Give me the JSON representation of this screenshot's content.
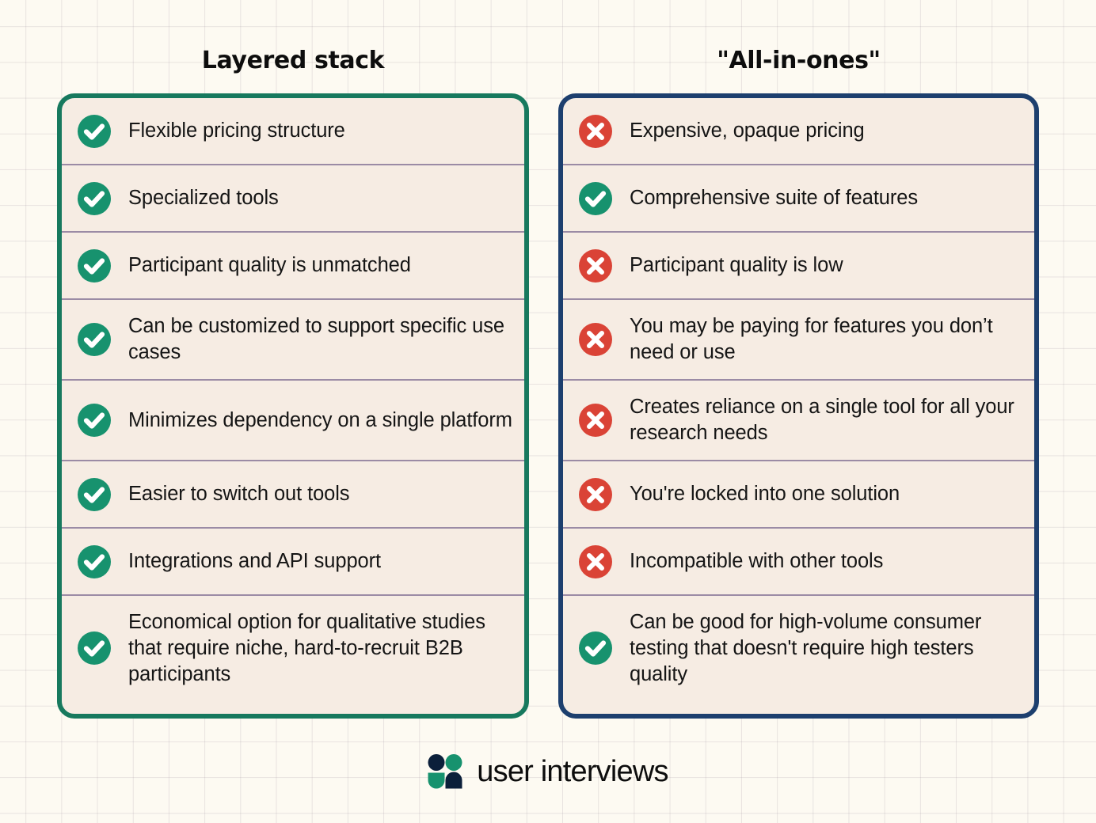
{
  "background": {
    "canvas_color": "#fdfaf2",
    "grid_line_color": "#9687961f"
  },
  "colors": {
    "green_accent": "#17795e",
    "green_icon": "#17926e",
    "navy_accent": "#1d3f6e",
    "navy_logo": "#0b1f3a",
    "red_icon": "#da4336",
    "card_background": "#f6ece3",
    "divider": "#9b8ba5",
    "text": "#151515"
  },
  "columns": [
    {
      "title": "Layered stack",
      "accent": "#17795e",
      "items": [
        {
          "icon": "check-icon",
          "status": "pro",
          "text": "Flexible pricing structure"
        },
        {
          "icon": "check-icon",
          "status": "pro",
          "text": "Specialized tools"
        },
        {
          "icon": "check-icon",
          "status": "pro",
          "text": "Participant quality is unmatched"
        },
        {
          "icon": "check-icon",
          "status": "pro",
          "text": "Can be customized to support specific use cases"
        },
        {
          "icon": "check-icon",
          "status": "pro",
          "text": "Minimizes dependency on a single platform"
        },
        {
          "icon": "check-icon",
          "status": "pro",
          "text": "Easier to switch out tools"
        },
        {
          "icon": "check-icon",
          "status": "pro",
          "text": "Integrations and API support"
        },
        {
          "icon": "check-icon",
          "status": "pro",
          "text": "Economical option for qualitative studies that require niche, hard-to-recruit B2B participants"
        }
      ]
    },
    {
      "title": "\"All-in-ones\"",
      "accent": "#1d3f6e",
      "items": [
        {
          "icon": "cross-icon",
          "status": "con",
          "text": "Expensive, opaque pricing"
        },
        {
          "icon": "check-icon",
          "status": "pro",
          "text": "Comprehensive suite of features"
        },
        {
          "icon": "cross-icon",
          "status": "con",
          "text": "Participant quality is low"
        },
        {
          "icon": "cross-icon",
          "status": "con",
          "text": "You may be paying for features you don’t need or use"
        },
        {
          "icon": "cross-icon",
          "status": "con",
          "text": "Creates reliance on a single tool for all your research needs"
        },
        {
          "icon": "cross-icon",
          "status": "con",
          "text": "You're locked into one solution"
        },
        {
          "icon": "cross-icon",
          "status": "con",
          "text": "Incompatible with other tools"
        },
        {
          "icon": "check-icon",
          "status": "pro",
          "text": "Can be good for high-volume consumer testing that doesn't require high testers quality"
        }
      ]
    }
  ],
  "footer": {
    "logo_mark": "user-interviews-logo-mark",
    "wordmark": "user interviews"
  }
}
